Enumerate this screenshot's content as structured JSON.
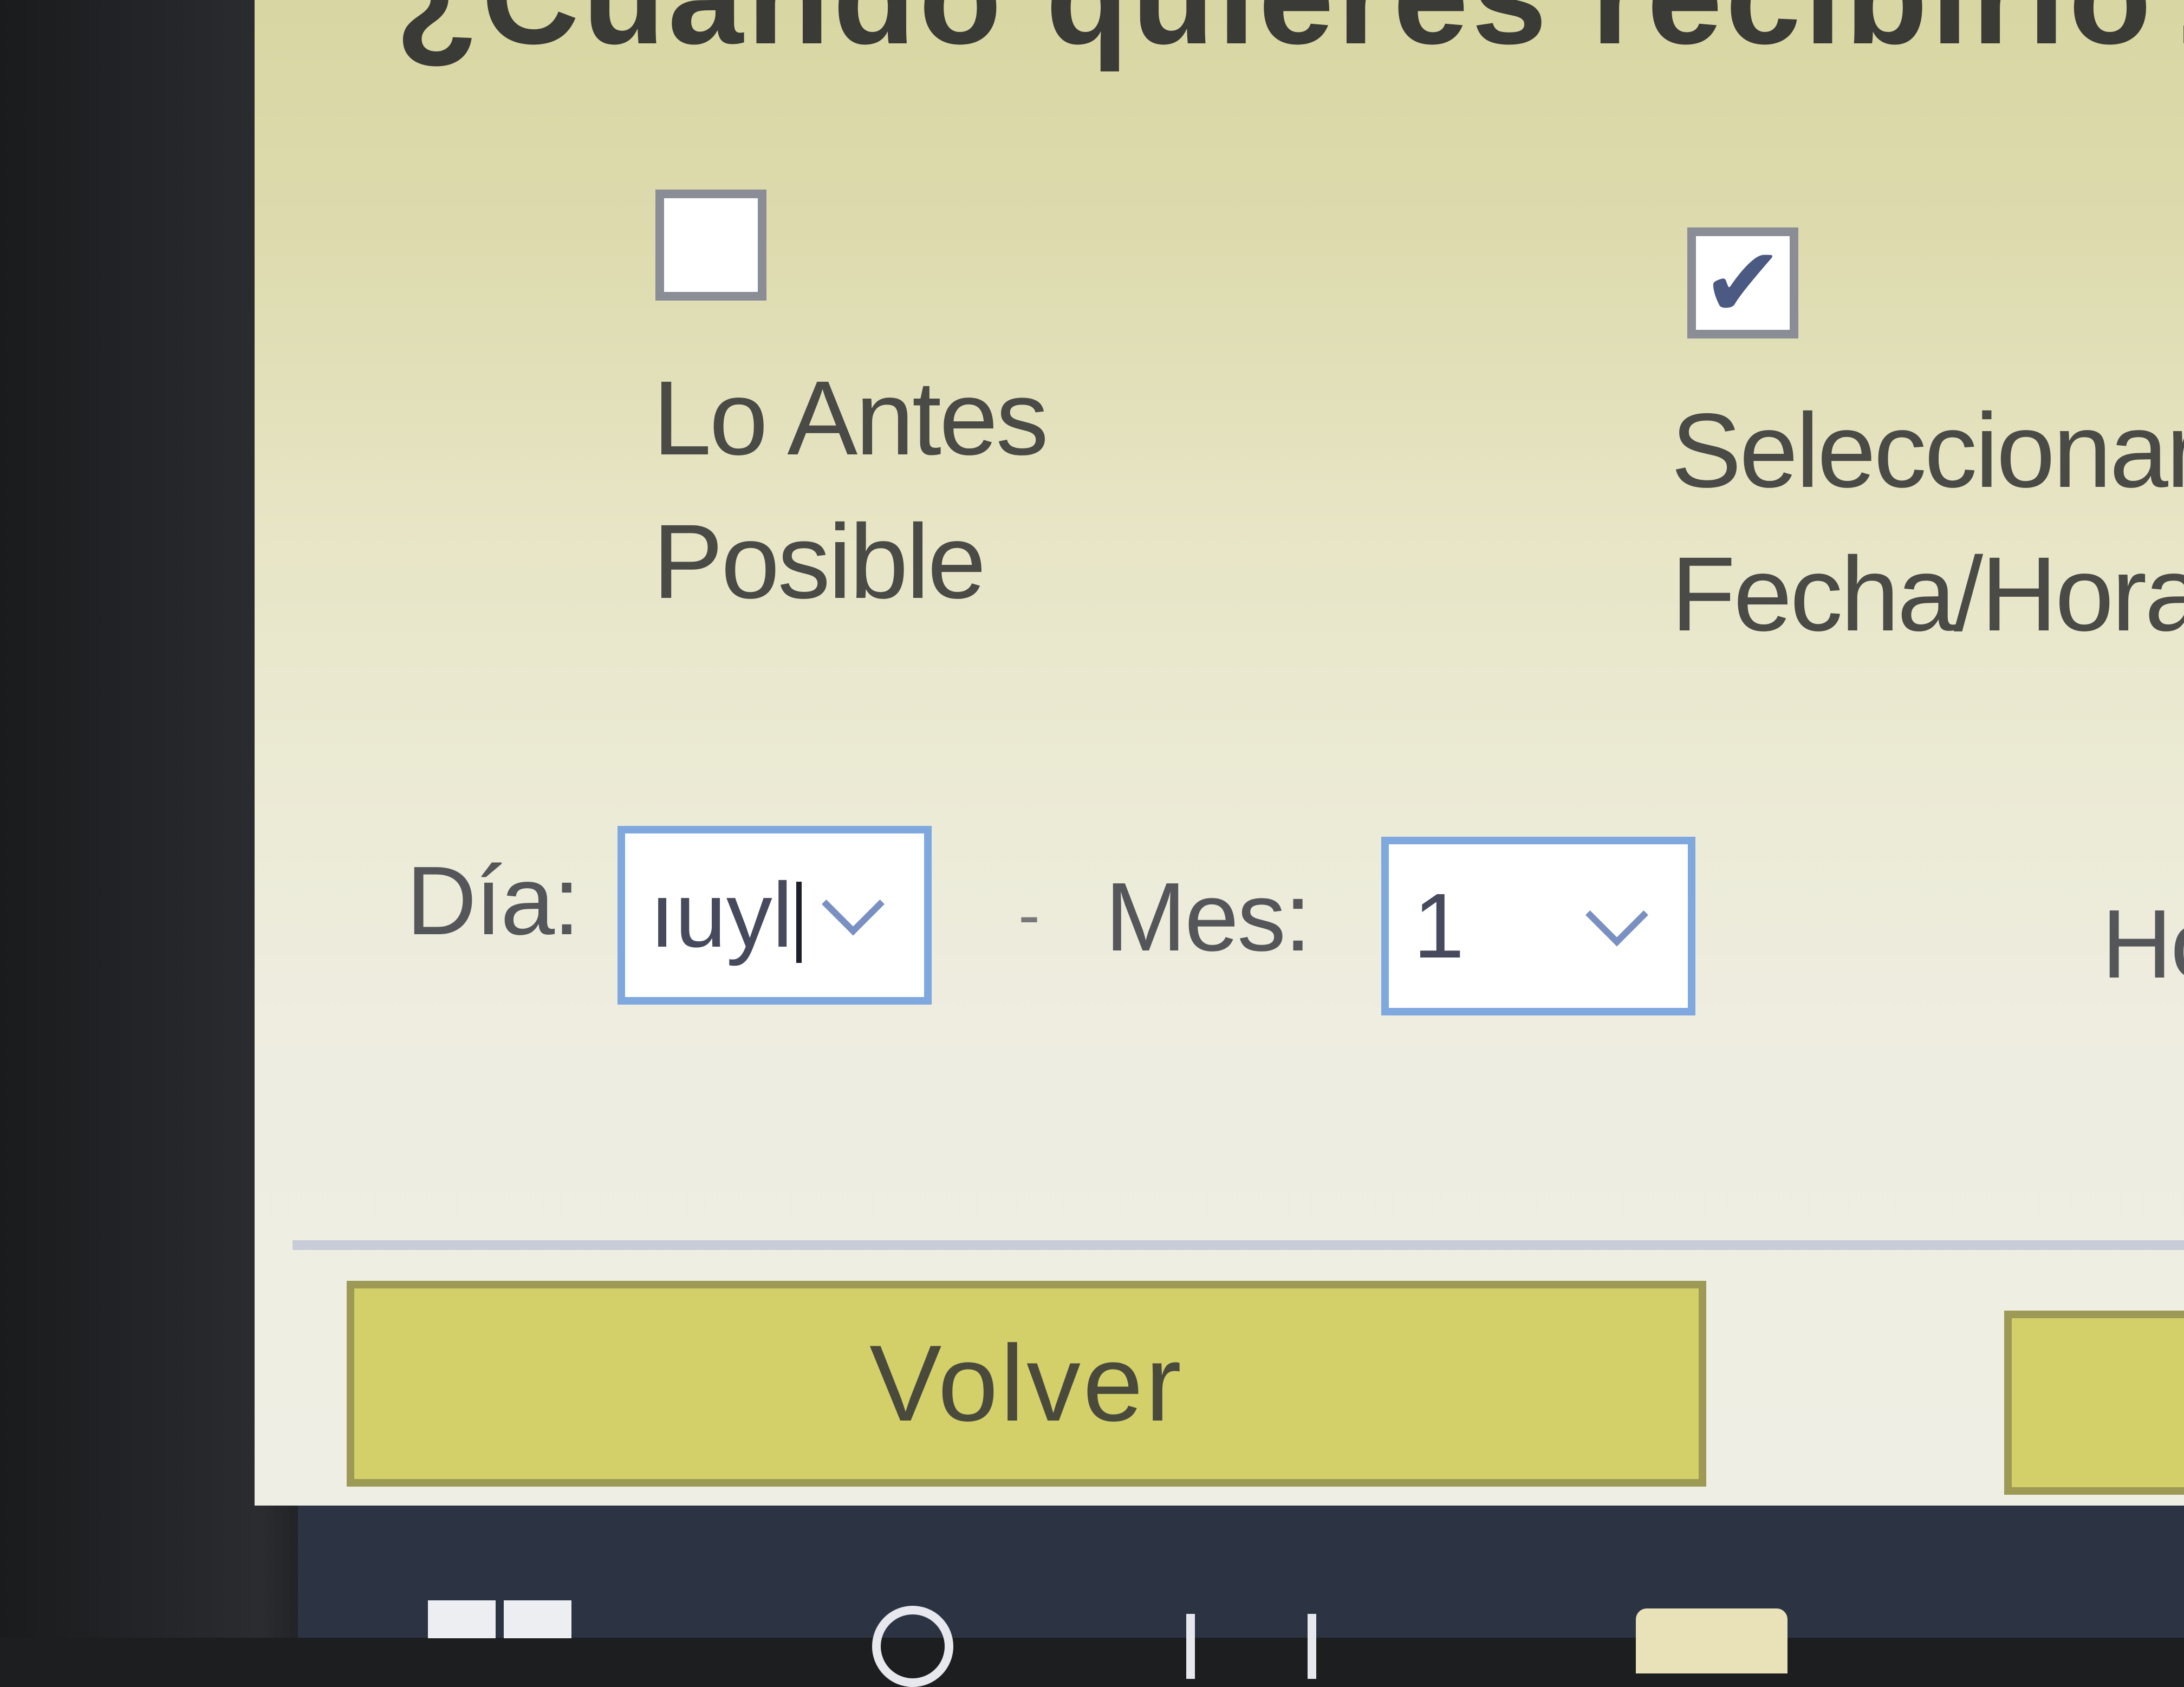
{
  "dialog": {
    "question": "¿Cuándo quieres recibirlo?"
  },
  "options": {
    "asap": {
      "label_line1": "Lo Antes",
      "label_line2": "Posible",
      "checked": false
    },
    "select_datetime": {
      "label_line1": "Seleccionar",
      "label_line2": "Fecha/Hora",
      "checked": true,
      "check_glyph": "✔"
    }
  },
  "date_fields": {
    "day_label": "Día:",
    "day_value": "ıuyl",
    "separator": "-",
    "month_label": "Mes:",
    "month_value": "1",
    "hour_label_partial": "Ho"
  },
  "buttons": {
    "back_label": "Volver"
  },
  "colors": {
    "panel_background": "#e6e4c3",
    "button_yellow": "#d3d069",
    "combo_focus_border": "#7ea8de",
    "taskbar": "#2c3444"
  },
  "taskbar": {
    "icons": [
      "windows-start-icon",
      "search-icon",
      "task-view-icon",
      "file-explorer-icon"
    ]
  }
}
